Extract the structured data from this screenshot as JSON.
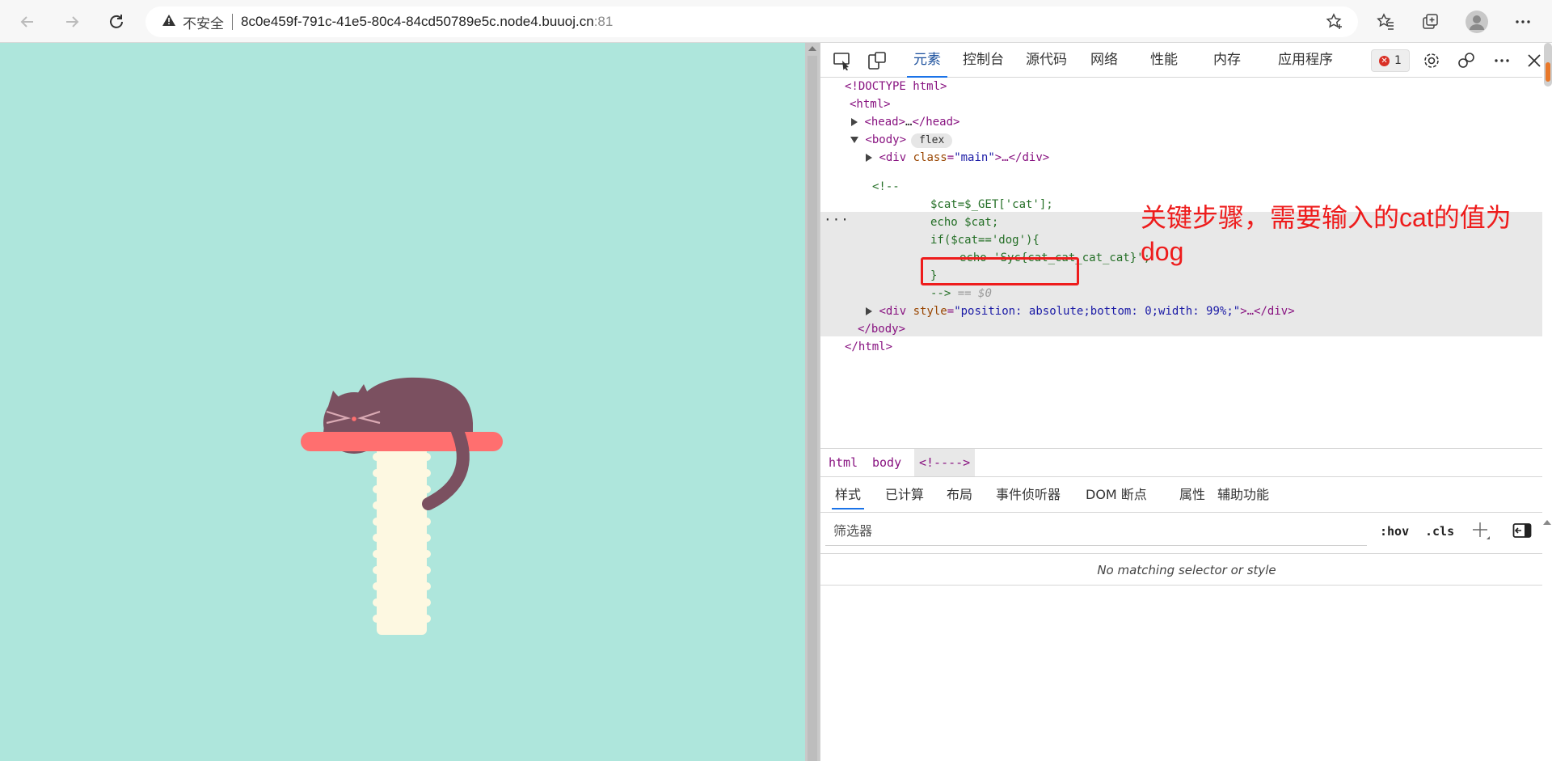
{
  "browser": {
    "security_label": "不安全",
    "url": "8c0e459f-791c-41e5-80c4-84cd50789e5c.node4.buuoj.cn",
    "port": ":81"
  },
  "devtools": {
    "tabs": [
      "元素",
      "控制台",
      "源代码",
      "网络",
      "性能",
      "内存",
      "应用程序"
    ],
    "error_count": "1",
    "dom": {
      "doctype": "<!DOCTYPE html>",
      "html_open": "<html>",
      "head_open": "<head>",
      "head_ellipsis": "…",
      "head_close": "</head>",
      "body_open": "<body>",
      "flex_badge": "flex",
      "div_main_open": "<div",
      "div_class_attr": "class",
      "div_class_val": "\"main\"",
      "div_main_rest": ">…</div>",
      "comment_open": "<!--",
      "code_line1": "$cat=$_GET['cat'];",
      "code_line2": "echo $cat;",
      "code_line3": "if($cat=='dog'){",
      "code_line4": "echo 'Syc{cat_cat_cat_cat}';",
      "code_line5": "}",
      "comment_close": "-->",
      "eq_marker": "== $0",
      "div2_open": "<div",
      "div2_attr": "style",
      "div2_val": "\"position: absolute;bottom: 0;width: 99%;\"",
      "div2_rest": ">…</div>",
      "body_close": "</body>",
      "html_close": "</html>",
      "dots": "···"
    },
    "annotation": "关键步骤，需要输入的cat的值为dog",
    "breadcrumbs": [
      "html",
      "body",
      "<!---->"
    ],
    "subtabs": [
      "样式",
      "已计算",
      "布局",
      "事件侦听器",
      "DOM 断点",
      "属性",
      "辅助功能"
    ],
    "filter_placeholder": "筛选器",
    "hov_label": ":hov",
    "cls_label": ".cls",
    "no_match": "No matching selector or style"
  },
  "colors": {
    "page_bg": "#aee6dc",
    "cat": "#7b5060",
    "shelf": "#ff6f6f",
    "post": "#fdf8e1",
    "annotation": "#ee1c1c"
  }
}
